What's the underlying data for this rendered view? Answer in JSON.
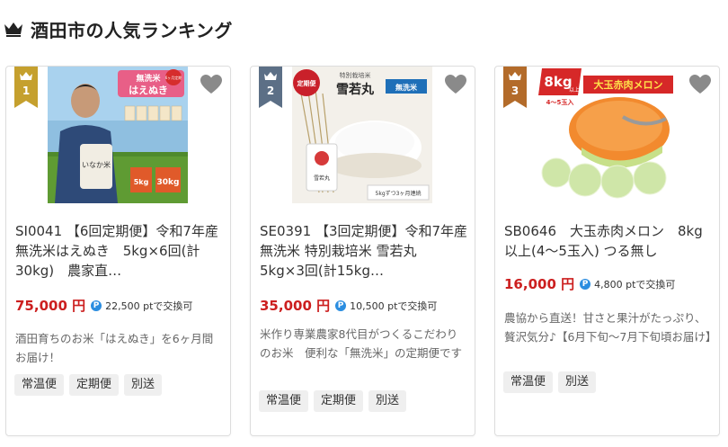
{
  "section": {
    "title": "酒田市の人気ランキング",
    "icon": "crown-icon"
  },
  "colors": {
    "rank1": "#c5a02e",
    "rank2": "#5c6f86",
    "rank3": "#b36b2a",
    "price": "#cc1f1f",
    "point_badge": "#2b8de0"
  },
  "products": [
    {
      "rank": "1",
      "title": "SI0041 【6回定期便】令和7年産 無洗米はえぬき　5kg×6回(計30kg)　農家直…",
      "price": "75,000 円",
      "point_icon": "P",
      "points": "22,500 ptで交換可",
      "description": "酒田育ちのお米「はえぬき」を6ヶ月間お届け！",
      "tags": [
        "常温便",
        "定期便",
        "別送"
      ],
      "image": {
        "badge_top": "無洗米",
        "badge_main": "はえぬき",
        "seal": "6ヶ月定期",
        "bag": "いなか米",
        "size_small": "5kg",
        "size_large": "30kg"
      }
    },
    {
      "rank": "2",
      "title": "SE0391 【3回定期便】令和7年産 無洗米 特別栽培米 雪若丸　5kg×3回(計15kg…",
      "price": "35,000 円",
      "point_icon": "P",
      "points": "10,500 ptで交換可",
      "description": "米作り専業農家8代目がつくるこだわりのお米　便利な「無洗米」の定期便です",
      "tags": [
        "常温便",
        "定期便",
        "別送"
      ],
      "image": {
        "seal": "定期便",
        "sub": "特別栽培米",
        "main": "雪若丸",
        "label": "無洗米",
        "bag": "雪若丸",
        "footer": "5kgずつ3ヶ月連続"
      }
    },
    {
      "rank": "3",
      "title": "SB0646　大玉赤肉メロン　8kg以上(4～5玉入) つる無し",
      "price": "16,000 円",
      "point_icon": "P",
      "points": "4,800 ptで交換可",
      "description": "農協から直送！甘さと果汁がたっぷり、贅沢気分♪【6月下旬～7月下旬頃お届け】",
      "tags": [
        "常温便",
        "別送"
      ],
      "image": {
        "weight": "8kg",
        "weight_sub": "以上",
        "banner": "大玉赤肉メロン",
        "count": "4～5玉入"
      }
    }
  ]
}
